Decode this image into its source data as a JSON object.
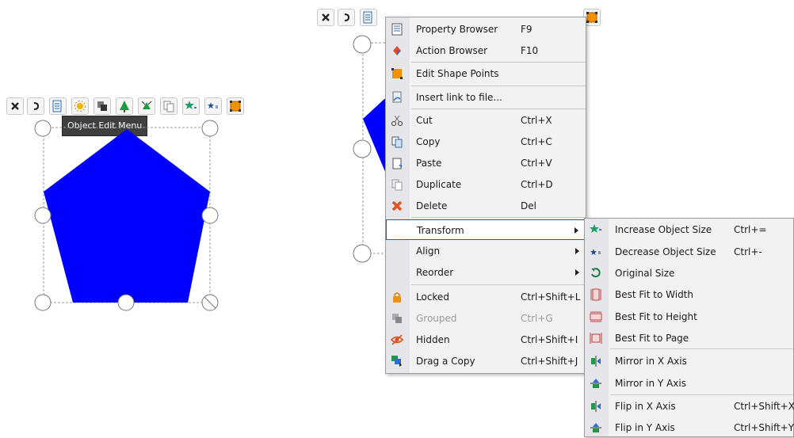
{
  "tooltip": "Object Edit Menu",
  "colors": {
    "shape_fill": "#0000ff",
    "accent": "#2e5a95"
  },
  "toolbar_icons": [
    "close-icon",
    "undo-icon",
    "object-edit-menu-icon",
    "visibility-icon",
    "layer-order-icon",
    "tree-grow-icon",
    "tree-shrink-icon",
    "duplicate-pages-icon",
    "star-increase-icon",
    "star-decrease-icon",
    "orange-square-icon"
  ],
  "context_menu": {
    "items": [
      {
        "label": "Property Browser",
        "shortcut": "F9",
        "icon": "property-browser-icon"
      },
      {
        "label": "Action Browser",
        "shortcut": "F10",
        "icon": "action-browser-icon"
      },
      {
        "label": "Edit Shape Points",
        "shortcut": "",
        "icon": "edit-shape-points-icon"
      },
      {
        "label": "Insert link to file...",
        "shortcut": "",
        "icon": "link-file-icon"
      },
      {
        "label": "Cut",
        "shortcut": "Ctrl+X",
        "icon": "scissors-icon"
      },
      {
        "label": "Copy",
        "shortcut": "Ctrl+C",
        "icon": "copy-icon"
      },
      {
        "label": "Paste",
        "shortcut": "Ctrl+V",
        "icon": "paste-icon"
      },
      {
        "label": "Duplicate",
        "shortcut": "Ctrl+D",
        "icon": "duplicate-icon"
      },
      {
        "label": "Delete",
        "shortcut": "Del",
        "icon": "delete-icon"
      },
      {
        "label": "Transform",
        "shortcut": "",
        "icon": "",
        "submenu": true,
        "highlighted": true
      },
      {
        "label": "Align",
        "shortcut": "",
        "icon": "",
        "submenu": true
      },
      {
        "label": "Reorder",
        "shortcut": "",
        "icon": "",
        "submenu": true
      },
      {
        "label": "Locked",
        "shortcut": "Ctrl+Shift+L",
        "icon": "lock-icon"
      },
      {
        "label": "Grouped",
        "shortcut": "Ctrl+G",
        "icon": "group-icon",
        "disabled": true
      },
      {
        "label": "Hidden",
        "shortcut": "Ctrl+Shift+I",
        "icon": "hidden-eye-icon"
      },
      {
        "label": "Drag a Copy",
        "shortcut": "Ctrl+Shift+J",
        "icon": "drag-copy-icon"
      }
    ]
  },
  "transform_submenu": {
    "items": [
      {
        "label": "Increase Object Size",
        "shortcut": "Ctrl+=",
        "icon": "increase-size-icon"
      },
      {
        "label": "Decrease Object Size",
        "shortcut": "Ctrl+-",
        "icon": "decrease-size-icon"
      },
      {
        "label": "Original Size",
        "shortcut": "",
        "icon": "original-size-icon"
      },
      {
        "label": "Best Fit to Width",
        "shortcut": "",
        "icon": "fit-width-icon"
      },
      {
        "label": "Best Fit to Height",
        "shortcut": "",
        "icon": "fit-height-icon"
      },
      {
        "label": "Best Fit to Page",
        "shortcut": "",
        "icon": "fit-page-icon"
      },
      {
        "label": "Mirror in X Axis",
        "shortcut": "",
        "icon": "mirror-x-icon"
      },
      {
        "label": "Mirror in Y Axis",
        "shortcut": "",
        "icon": "mirror-y-icon"
      },
      {
        "label": "Flip in X Axis",
        "shortcut": "Ctrl+Shift+X",
        "icon": "flip-x-icon"
      },
      {
        "label": "Flip in Y Axis",
        "shortcut": "Ctrl+Shift+Y",
        "icon": "flip-y-icon"
      }
    ]
  }
}
